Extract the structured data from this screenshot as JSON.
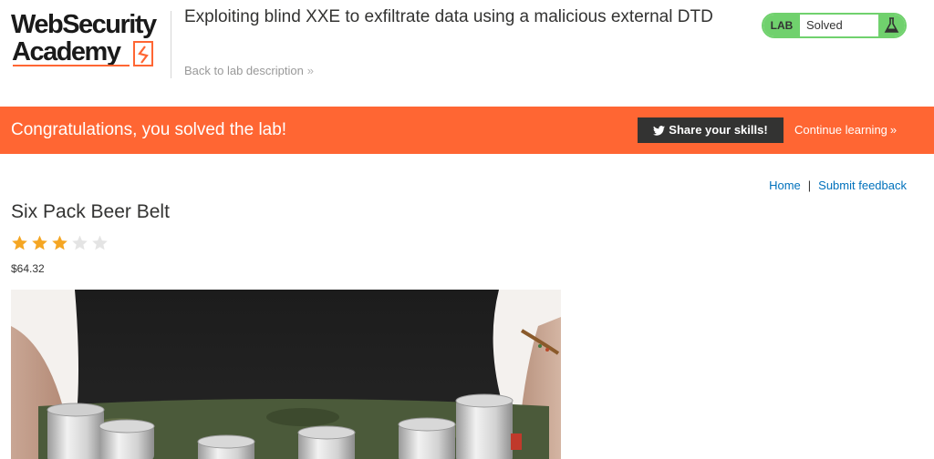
{
  "logo": {
    "line1": "WebSecurity",
    "line2": "Academy"
  },
  "header": {
    "lab_title": "Exploiting blind XXE to exfiltrate data using a malicious external DTD",
    "back_link": "Back to lab description",
    "status_badge": "LAB",
    "status_text": "Solved"
  },
  "banner": {
    "message": "Congratulations, you solved the lab!",
    "share_label": "Share your skills!",
    "continue_label": "Continue learning"
  },
  "nav": {
    "home": "Home",
    "separator": "|",
    "feedback": "Submit feedback"
  },
  "product": {
    "title": "Six Pack Beer Belt",
    "rating": 3,
    "rating_max": 5,
    "price": "$64.32"
  },
  "colors": {
    "brand_orange": "#ff6633",
    "solved_green": "#70d16d",
    "star_filled": "#f5a623",
    "star_empty": "#e4e4e4",
    "link_blue": "#0071bc",
    "dark_button": "#333332"
  }
}
